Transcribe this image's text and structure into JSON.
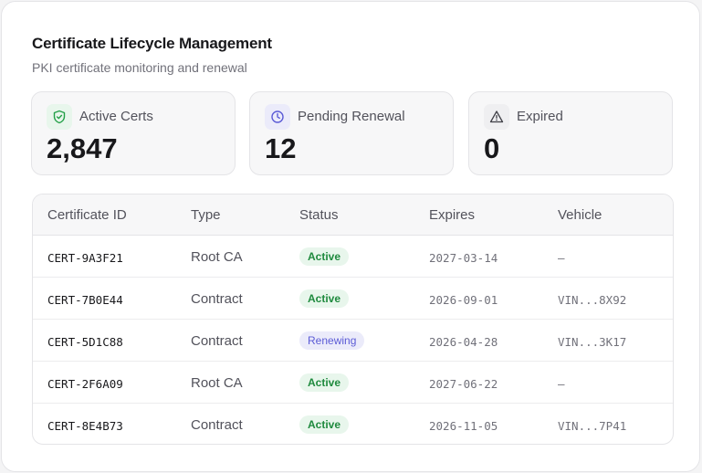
{
  "header": {
    "title": "Certificate Lifecycle Management",
    "subtitle": "PKI certificate monitoring and renewal"
  },
  "stats": [
    {
      "icon": "shield-check-icon",
      "label": "Active Certs",
      "value": "2,847",
      "color": "#22a047",
      "bg": "#e8f6ec"
    },
    {
      "icon": "clock-icon",
      "label": "Pending Renewal",
      "value": "12",
      "color": "#5b5bd6",
      "bg": "#ebebfa"
    },
    {
      "icon": "warning-triangle-icon",
      "label": "Expired",
      "value": "0",
      "color": "#52525b",
      "bg": "#efeff1"
    }
  ],
  "table": {
    "columns": [
      "Certificate ID",
      "Type",
      "Status",
      "Expires",
      "Vehicle"
    ],
    "rows": [
      {
        "id": "CERT-9A3F21",
        "type": "Root CA",
        "status": "Active",
        "expires": "2027-03-14",
        "vehicle": "—"
      },
      {
        "id": "CERT-7B0E44",
        "type": "Contract",
        "status": "Active",
        "expires": "2026-09-01",
        "vehicle": "VIN...8X92"
      },
      {
        "id": "CERT-5D1C88",
        "type": "Contract",
        "status": "Renewing",
        "expires": "2026-04-28",
        "vehicle": "VIN...3K17"
      },
      {
        "id": "CERT-2F6A09",
        "type": "Root CA",
        "status": "Active",
        "expires": "2027-06-22",
        "vehicle": "—"
      },
      {
        "id": "CERT-8E4B73",
        "type": "Contract",
        "status": "Active",
        "expires": "2026-11-05",
        "vehicle": "VIN...7P41"
      }
    ]
  }
}
